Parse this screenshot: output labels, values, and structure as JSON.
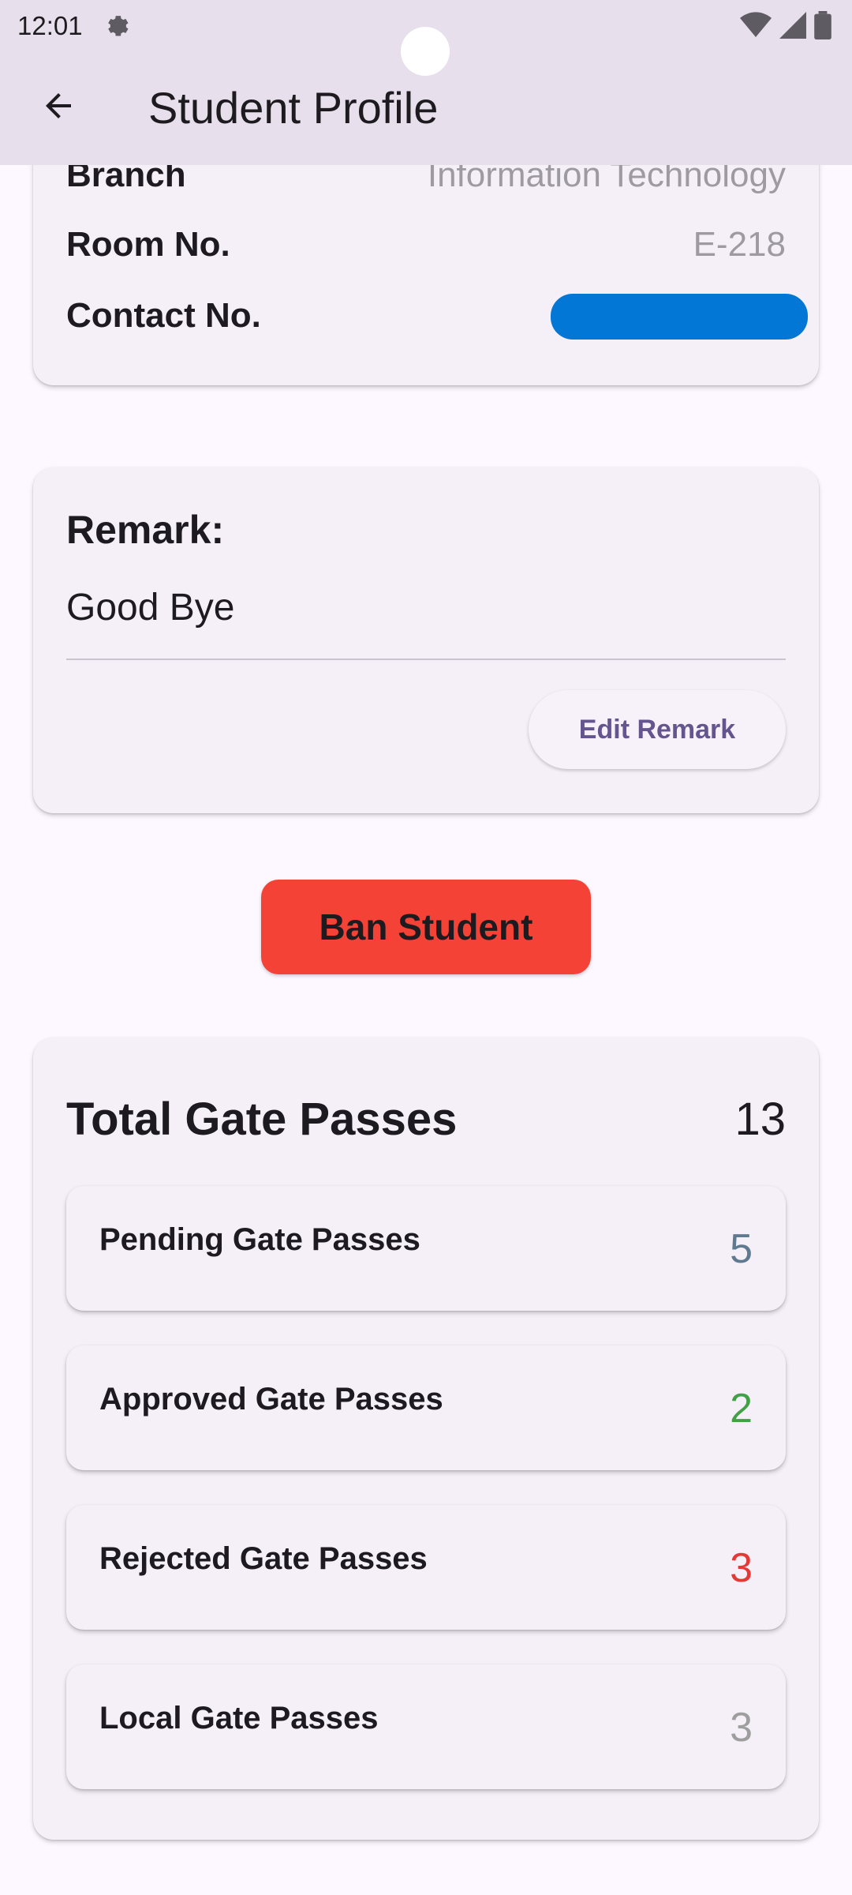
{
  "status_bar": {
    "time": "12:01"
  },
  "app_bar": {
    "title": "Student Profile"
  },
  "info": {
    "branch_label": "Branch",
    "branch_value": "Information Technology",
    "room_label": "Room No.",
    "room_value": "E-218",
    "contact_label": "Contact No."
  },
  "remark": {
    "title": "Remark:",
    "text": "Good Bye",
    "edit_label": "Edit Remark"
  },
  "ban_button_label": "Ban Student",
  "gate_passes": {
    "title": "Total Gate Passes",
    "total": "13",
    "items": [
      {
        "label": "Pending Gate Passes",
        "count": "5",
        "color": "#5f7a8f"
      },
      {
        "label": "Approved Gate Passes",
        "count": "2",
        "color": "#43a047"
      },
      {
        "label": "Rejected Gate Passes",
        "count": "3",
        "color": "#e53935"
      },
      {
        "label": "Local Gate Passes",
        "count": "3",
        "color": "#9e9e9e"
      }
    ]
  },
  "colors": {
    "ban_button": "#f44336",
    "redaction": "#0277d6",
    "app_bar": "#e7e0ec"
  }
}
